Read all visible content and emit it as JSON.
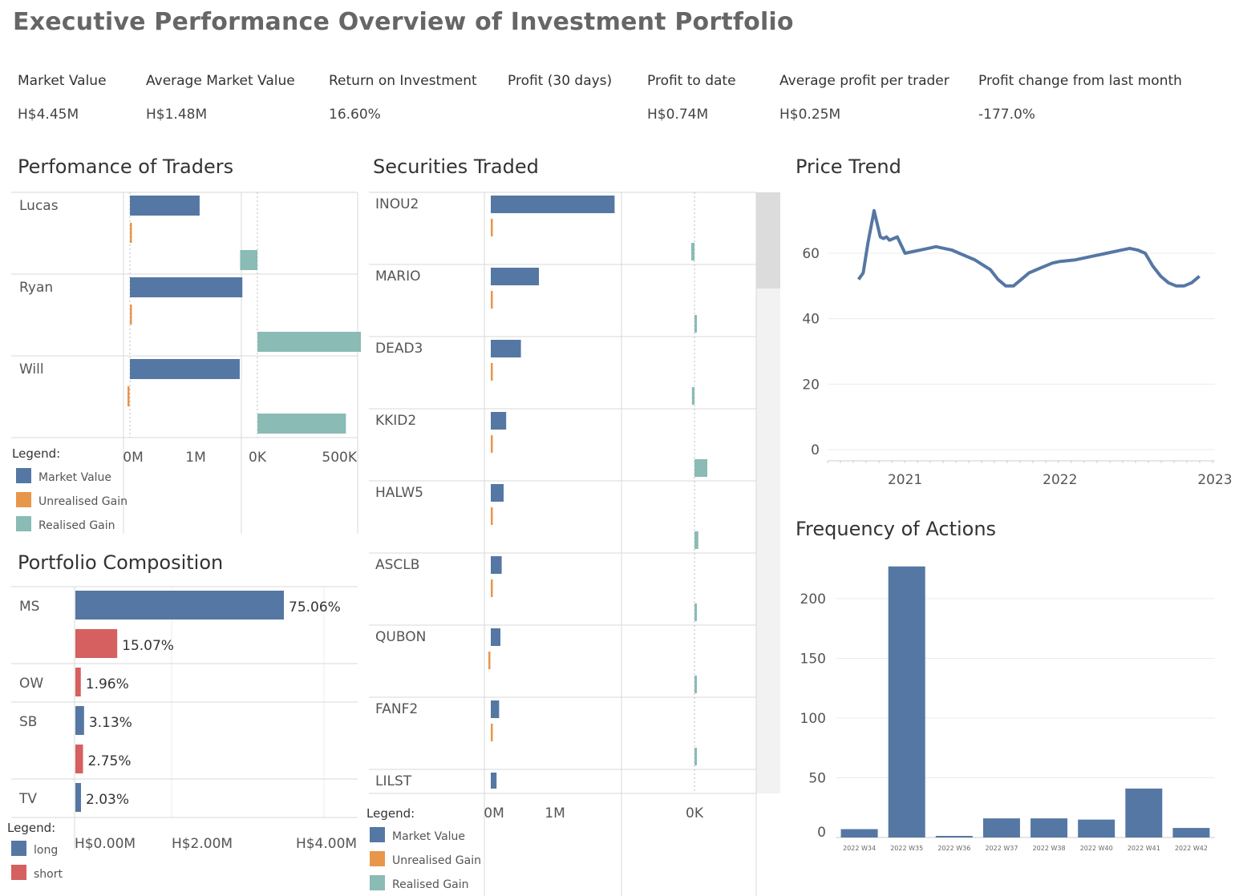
{
  "dashboard": {
    "title": "Executive Performance  Overview of Investment Portfolio"
  },
  "kpis": [
    {
      "label": "Market Value",
      "value": "H$4.45M"
    },
    {
      "label": "Average Market Value",
      "value": "H$1.48M"
    },
    {
      "label": "Return on Investment",
      "value": "16.60%"
    },
    {
      "label": "Profit (30 days)",
      "value": ""
    },
    {
      "label": "Profit to date",
      "value": "H$0.74M"
    },
    {
      "label": "Average profit per trader",
      "value": "H$0.25M"
    },
    {
      "label": "Profit change from last month",
      "value": "-177.0%"
    }
  ],
  "colors": {
    "market_value": "#5577a4",
    "unrealised_gain": "#e8964a",
    "realised_gain": "#8abbb5",
    "long": "#5577a4",
    "short": "#d65f5f",
    "grid": "#d9d9d9"
  },
  "chart_data": [
    {
      "id": "traders",
      "type": "bar",
      "title": "Perfomance of Traders",
      "categories": [
        "Lucas",
        "Ryan",
        "Will"
      ],
      "series": [
        {
          "name": "Market Value",
          "values": [
            1060000,
            1710000,
            1670000
          ]
        },
        {
          "name": "Unrealised Gain",
          "values": [
            5000,
            10000,
            -15000
          ]
        },
        {
          "name": "Realised Gain",
          "values": [
            -90000,
            690000,
            460000
          ]
        }
      ],
      "panel1_ticks": [
        "0M",
        "1M"
      ],
      "panel2_ticks": [
        "0K",
        "500K"
      ],
      "legend_title": "Legend:",
      "legend": [
        "Market Value",
        "Unrealised Gain",
        "Realised Gain"
      ]
    },
    {
      "id": "securities",
      "type": "bar",
      "title": "Securities Traded",
      "categories": [
        "INOU2",
        "MARIO",
        "DEAD3",
        "KKID2",
        "HALW5",
        "ASCLB",
        "QUBON",
        "FANF2",
        "LILST"
      ],
      "series": [
        {
          "name": "Market Value",
          "values": [
            1930000,
            750000,
            470000,
            240000,
            200000,
            170000,
            150000,
            130000,
            90000
          ]
        },
        {
          "name": "Unrealised Gain",
          "values": [
            5000,
            4000,
            4000,
            3000,
            3000,
            3000,
            -3000,
            3000,
            null
          ]
        },
        {
          "name": "Realised Gain",
          "values": [
            -5000,
            3000,
            -4000,
            20000,
            6000,
            2000,
            2000,
            1000,
            null
          ]
        }
      ],
      "panel1_ticks": [
        "0M",
        "1M"
      ],
      "panel2_ticks": [
        "0K"
      ],
      "legend_title": "Legend:",
      "legend": [
        "Market Value",
        "Unrealised Gain",
        "Realised Gain"
      ]
    },
    {
      "id": "price",
      "type": "line",
      "title": "Price Trend",
      "x_ticks": [
        "2021",
        "2022",
        "2023"
      ],
      "y_ticks": [
        0,
        20,
        40,
        60
      ],
      "ylim": [
        0,
        74
      ],
      "x": [
        2020.7,
        2020.73,
        2020.76,
        2020.8,
        2020.83,
        2020.84,
        2020.86,
        2020.88,
        2020.9,
        2020.95,
        2021.0,
        2021.1,
        2021.2,
        2021.3,
        2021.35,
        2021.45,
        2021.55,
        2021.6,
        2021.65,
        2021.7,
        2021.75,
        2021.8,
        2021.85,
        2021.9,
        2021.95,
        2022.0,
        2022.1,
        2022.2,
        2022.3,
        2022.4,
        2022.45,
        2022.5,
        2022.55,
        2022.6,
        2022.65,
        2022.7,
        2022.75,
        2022.8,
        2022.85,
        2022.9
      ],
      "y": [
        52,
        54,
        63,
        73,
        67,
        65,
        64.5,
        65,
        64,
        65,
        60,
        61,
        62,
        61,
        60,
        58,
        55,
        52,
        50,
        50,
        52,
        54,
        55,
        56,
        57,
        57.5,
        58,
        59,
        60,
        61,
        61.5,
        61,
        60,
        56,
        53,
        51,
        50,
        50,
        51,
        53
      ]
    },
    {
      "id": "frequency",
      "type": "bar",
      "title": "Frequency of Actions",
      "categories": [
        "2022 W34",
        "2022 W35",
        "2022 W36",
        "2022 W37",
        "2022 W38",
        "2022 W40",
        "2022 W41",
        "2022 W42"
      ],
      "values": [
        7,
        227,
        1,
        16,
        16,
        15,
        41,
        8
      ],
      "y_ticks": [
        0,
        50,
        100,
        150,
        200
      ],
      "ylim": [
        0,
        230
      ]
    },
    {
      "id": "composition",
      "type": "bar",
      "title": "Portfolio Composition",
      "categories": [
        "MS",
        "OW",
        "SB",
        "TV"
      ],
      "bars": [
        {
          "category": "MS",
          "type": "long",
          "value": 3340000,
          "label": "75.06%"
        },
        {
          "category": "MS",
          "type": "short",
          "value": 670000,
          "label": "15.07%"
        },
        {
          "category": "OW",
          "type": "short",
          "value": 87000,
          "label": "1.96%"
        },
        {
          "category": "SB",
          "type": "long",
          "value": 139000,
          "label": "3.13%"
        },
        {
          "category": "SB",
          "type": "short",
          "value": 122000,
          "label": "2.75%"
        },
        {
          "category": "TV",
          "type": "long",
          "value": 90000,
          "label": "2.03%"
        }
      ],
      "x_ticks": [
        "H$0.00M",
        "H$2.00M",
        "H$4.00M"
      ],
      "legend_title": "Legend:",
      "legend": [
        "long",
        "short"
      ]
    }
  ]
}
